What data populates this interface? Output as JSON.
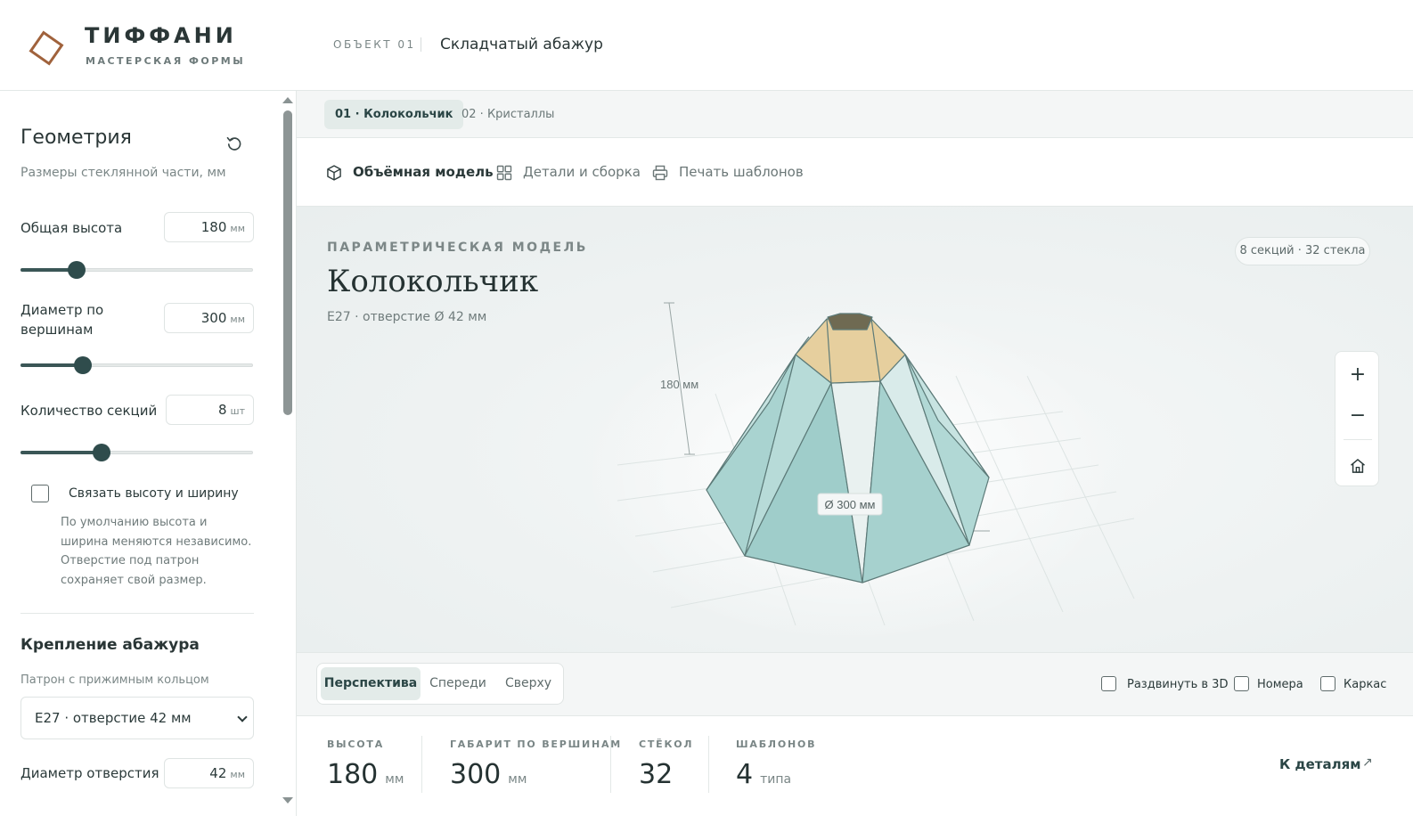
{
  "header": {
    "brand_title": "ТИФФАНИ",
    "brand_subtitle": "МАСТЕРСКАЯ ФОРМЫ",
    "object_label": "ОБЪЕКТ 01",
    "object_name": "Складчатый абажур"
  },
  "sidebar": {
    "geometry": {
      "title": "Геометрия",
      "subtitle": "Размеры стеклянной части, мм",
      "reset_icon": "reset-icon",
      "height": {
        "label": "Общая высота",
        "value": "180",
        "unit": "мм",
        "slider_fraction": 0.24
      },
      "diameter": {
        "label": "Диаметр по вершинам",
        "value": "300",
        "unit": "мм",
        "slider_fraction": 0.27
      },
      "sections": {
        "label": "Количество секций",
        "value": "8",
        "unit": "шт",
        "slider_fraction": 0.35
      },
      "link_checkbox": {
        "label": "Связать высоту и ширину",
        "checked": false
      },
      "hint": "По умолчанию высота и ширина меняются независимо. Отверстие под патрон сохраняет свой размер."
    },
    "mount": {
      "title": "Крепление абажура",
      "socket_label": "Патрон с прижимным кольцом",
      "socket_value": "E27 · отверстие 42 мм",
      "hole": {
        "label": "Диаметр отверстия",
        "value": "42",
        "unit": "мм"
      }
    }
  },
  "main": {
    "subtabs": [
      {
        "label": "01 · Колокольчик",
        "active": true
      },
      {
        "label": "02 · Кристаллы",
        "active": false
      }
    ],
    "tabs": [
      {
        "label": "Объёмная модель",
        "icon": "cube-icon",
        "active": true
      },
      {
        "label": "Детали и сборка",
        "icon": "grid-icon",
        "active": false
      },
      {
        "label": "Печать шаблонов",
        "icon": "printer-icon",
        "active": false
      }
    ],
    "viewport": {
      "eyebrow": "ПАРАМЕТРИЧЕСКАЯ МОДЕЛЬ",
      "title": "Колокольчик",
      "meta": "E27 · отверстие Ø 42 мм",
      "badge": "8 секций · 32 стекла",
      "height_dim": "180 мм",
      "diameter_dim": "Ø 300 мм",
      "zoom_in": "+",
      "zoom_out": "−",
      "home_icon": "home-icon",
      "colors": {
        "glass": "#a9d3d0",
        "top_ring": "#e6cf9e",
        "edge": "#5c7a78"
      }
    },
    "views": [
      {
        "label": "Перспектива",
        "active": true
      },
      {
        "label": "Спереди",
        "active": false
      },
      {
        "label": "Сверху",
        "active": false
      }
    ],
    "toggles": [
      {
        "label": "Раздвинуть в 3D",
        "checked": false
      },
      {
        "label": "Номера",
        "checked": false
      },
      {
        "label": "Каркас",
        "checked": false
      }
    ],
    "stats": [
      {
        "label": "ВЫСОТА",
        "value": "180",
        "unit": "мм"
      },
      {
        "label": "ГАБАРИТ ПО ВЕРШИНАМ",
        "value": "300",
        "unit": "мм"
      },
      {
        "label": "СТЁКОЛ",
        "value": "32",
        "unit": ""
      },
      {
        "label": "ШАБЛОНОВ",
        "value": "4",
        "unit": "типа"
      }
    ],
    "details_link": "К деталям",
    "details_arrow": "↗"
  }
}
